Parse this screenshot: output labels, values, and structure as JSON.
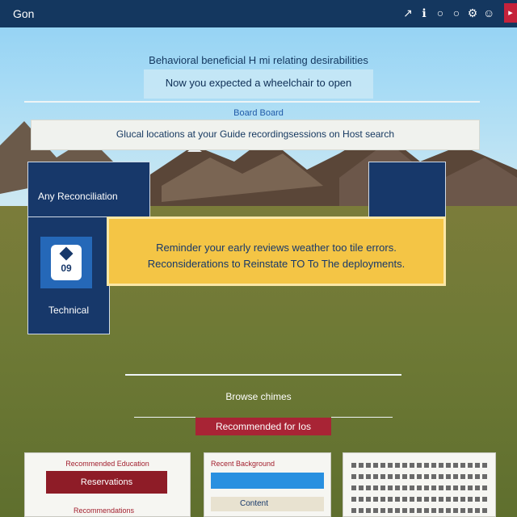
{
  "topbar": {
    "title": "Gon",
    "icons": [
      "cursor-icon",
      "info-icon",
      "circle-icon",
      "circle-icon",
      "gear-icon",
      "person-icon"
    ]
  },
  "hero": {
    "headline": "Behavioral beneficial H mi relating desirabilities",
    "subline": "Now you expected a wheelchair to open"
  },
  "section": {
    "label": "Board Board",
    "info": "Glucal locations at your Guide recordingsessions on Host search"
  },
  "panels": {
    "a_label": "Any Reconciliation",
    "badge_number": "09",
    "c_label": "Technical"
  },
  "notice": {
    "line1": "Reminder your early reviews weather too tile errors.",
    "line2": "Reconsiderations to Reinstate TO To The deployments."
  },
  "bottom": {
    "label": "Browse chimes",
    "button": "Recommended for Ios"
  },
  "cards": {
    "card1_title": "Recommended Education",
    "card1_button": "Reservations",
    "card1_foot": "Recommendations",
    "card2_title": "Recent Background",
    "card2_foot": "Content"
  },
  "colors": {
    "navy": "#17386a",
    "topbar": "#14375f",
    "accent_yellow": "#f4c545",
    "accent_red": "#a82435"
  }
}
